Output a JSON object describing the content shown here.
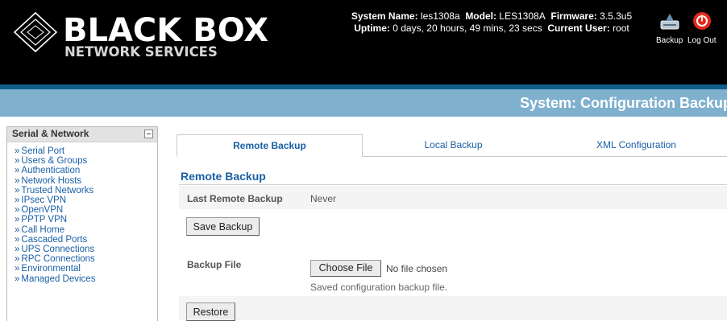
{
  "brand": {
    "name": "BLACK BOX",
    "tagline": "NETWORK SERVICES"
  },
  "system_info": {
    "system_name_label": "System Name:",
    "system_name": "les1308a",
    "model_label": "Model:",
    "model": "LES1308A",
    "firmware_label": "Firmware:",
    "firmware": "3.5.3u5",
    "uptime_label": "Uptime:",
    "uptime": "0 days, 20 hours, 49 mins, 23 secs",
    "user_label": "Current User:",
    "user": "root"
  },
  "header_buttons": {
    "backup_label": "Backup",
    "logout_label": "Log Out"
  },
  "page_title": "System: Configuration Backup",
  "sidebar": {
    "section_title": "Serial & Network",
    "items": [
      {
        "label": "Serial Port"
      },
      {
        "label": "Users & Groups"
      },
      {
        "label": "Authentication"
      },
      {
        "label": "Network Hosts"
      },
      {
        "label": "Trusted Networks"
      },
      {
        "label": "IPsec VPN"
      },
      {
        "label": "OpenVPN"
      },
      {
        "label": "PPTP VPN"
      },
      {
        "label": "Call Home"
      },
      {
        "label": "Cascaded Ports"
      },
      {
        "label": "UPS Connections"
      },
      {
        "label": "RPC Connections"
      },
      {
        "label": "Environmental"
      },
      {
        "label": "Managed Devices"
      }
    ],
    "bullet": "»"
  },
  "tabs": [
    {
      "label": "Remote Backup",
      "active": true
    },
    {
      "label": "Local Backup",
      "active": false
    },
    {
      "label": "XML Configuration",
      "active": false
    }
  ],
  "remote_backup": {
    "section_title": "Remote Backup",
    "last_backup_label": "Last Remote Backup",
    "last_backup_value": "Never",
    "save_button": "Save Backup",
    "backup_file_label": "Backup File",
    "choose_file_button": "Choose File",
    "no_file_text": "No file chosen",
    "backup_file_hint": "Saved configuration backup file.",
    "restore_button": "Restore"
  },
  "colors": {
    "header_bg": "#000000",
    "accent_blue": "#0f5f8c",
    "title_band": "#7fb0ce",
    "link_blue": "#1a5fa6",
    "logout_red": "#e0291b"
  }
}
